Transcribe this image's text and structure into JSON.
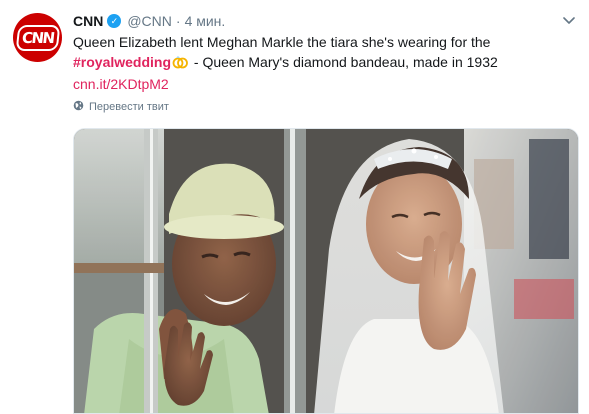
{
  "account": {
    "name": "CNN",
    "handle": "@CNN",
    "separator": "·",
    "time": "4 мин.",
    "avatar_text": "CNN",
    "verified_icon": "verified-badge-icon"
  },
  "tweet": {
    "text_part1": "Queen Elizabeth lent Meghan Markle the tiara she's wearing for the ",
    "hashtag": "#royalwedding",
    "ring_emoji": "ring-emoji-icon",
    "text_part2": " - Queen Mary's diamond bandeau, made in 1932",
    "link": "cnn.it/2KDtpM2"
  },
  "translate": {
    "label": "Перевести твит",
    "icon": "globe-icon"
  },
  "menu": {
    "icon": "chevron-down-icon"
  },
  "colors": {
    "brand_red": "#cc0000",
    "hashtag_link": "#e0245e",
    "secondary_text": "#657786",
    "verified_blue": "#1da1f2"
  }
}
